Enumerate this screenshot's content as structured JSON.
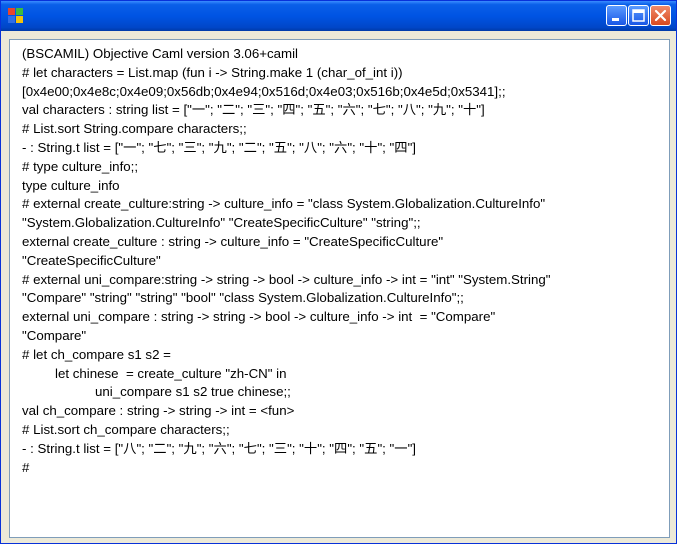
{
  "window": {
    "title": "",
    "titlebar_color": "#0054e3",
    "controls": {
      "minimize_icon": "minimize-icon",
      "maximize_icon": "maximize-icon",
      "close_icon": "close-icon"
    }
  },
  "console": {
    "lines": [
      "(BSCAMIL) Objective Caml version 3.06+camil",
      "# let characters = List.map (fun i -> String.make 1 (char_of_int i))",
      "[0x4e00;0x4e8c;0x4e09;0x56db;0x4e94;0x516d;0x4e03;0x516b;0x4e5d;0x5341];;",
      "val characters : string list = [\"一\"; \"二\"; \"三\"; \"四\"; \"五\"; \"六\"; \"七\"; \"八\"; \"九\"; \"十\"]",
      "# List.sort String.compare characters;;",
      "- : String.t list = [\"一\"; \"七\"; \"三\"; \"九\"; \"二\"; \"五\"; \"八\"; \"六\"; \"十\"; \"四\"]",
      "# type culture_info;;",
      "type culture_info",
      "# external create_culture:string -> culture_info = \"class System.Globalization.CultureInfo\"",
      "\"System.Globalization.CultureInfo\" \"CreateSpecificCulture\" \"string\";;",
      "external create_culture : string -> culture_info = \"CreateSpecificCulture\"",
      "\"CreateSpecificCulture\"",
      "# external uni_compare:string -> string -> bool -> culture_info -> int = \"int\" \"System.String\"",
      "\"Compare\" \"string\" \"string\" \"bool\" \"class System.Globalization.CultureInfo\";;",
      "external uni_compare : string -> string -> bool -> culture_info -> int  = \"Compare\"",
      "\"Compare\"",
      "# let ch_compare s1 s2 =",
      "let chinese  = create_culture \"zh-CN\" in",
      "uni_compare s1 s2 true chinese;;",
      "val ch_compare : string -> string -> int = <fun>",
      "# List.sort ch_compare characters;;",
      "- : String.t list = [\"八\"; \"二\"; \"九\"; \"六\"; \"七\"; \"三\"; \"十\"; \"四\"; \"五\"; \"一\"]",
      "#"
    ]
  }
}
